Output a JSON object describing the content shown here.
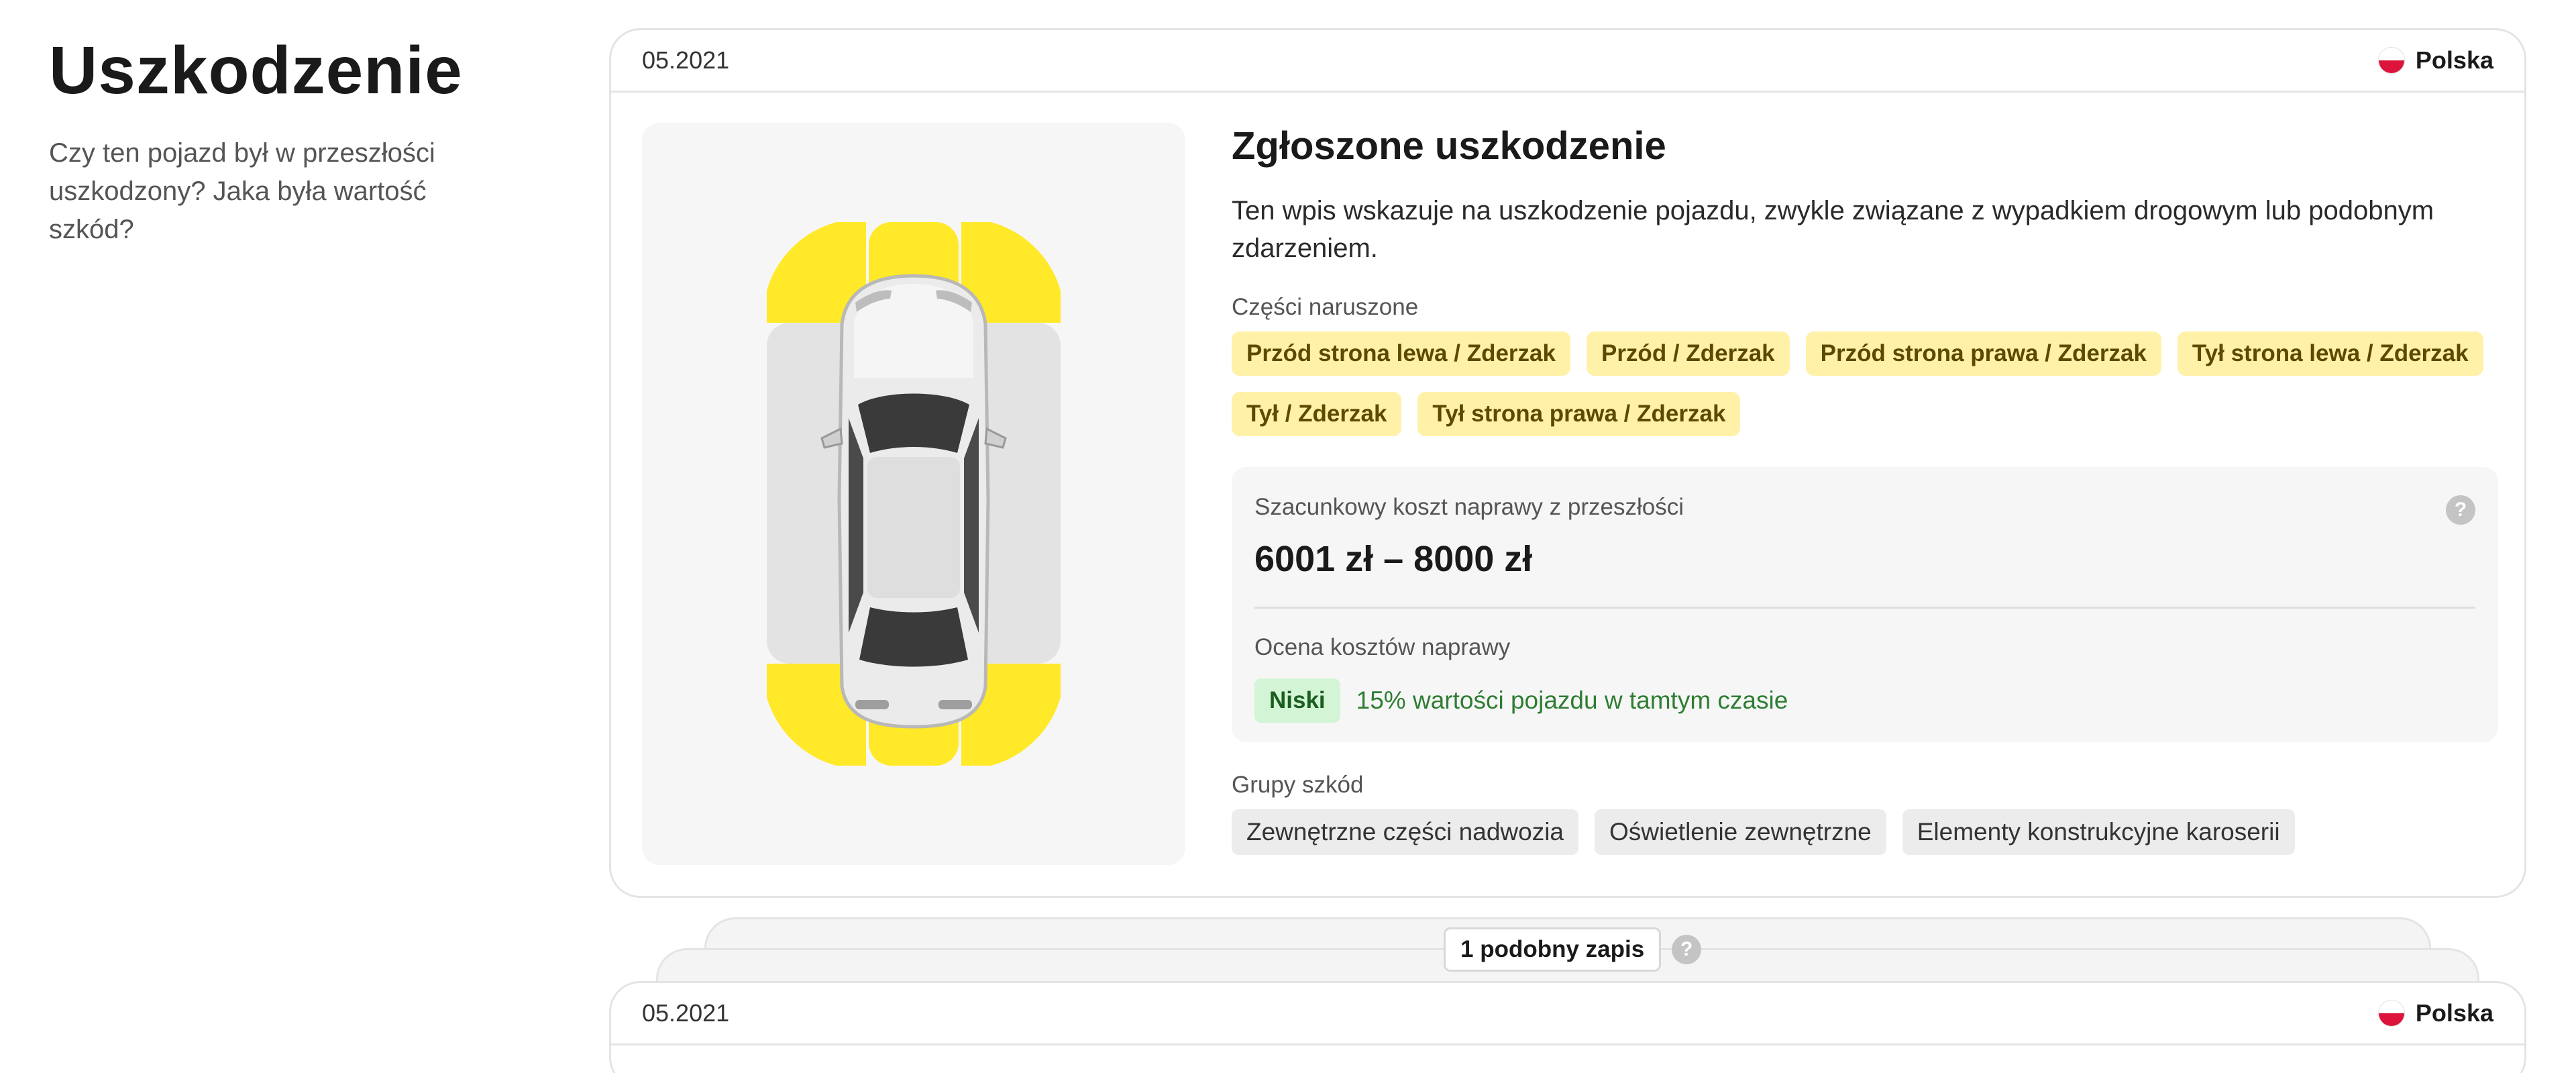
{
  "section": {
    "title": "Uszkodzenie",
    "description": "Czy ten pojazd był w przeszłości uszkodzony? Jaka była wartość szkód?"
  },
  "record": {
    "date": "05.2021",
    "country": "Polska",
    "title": "Zgłoszone uszkodzenie",
    "description": "Ten wpis wskazuje na uszkodzenie pojazdu, zwykle związane z wypadkiem drogowym lub podobnym zdarzeniem.",
    "parts_label": "Części naruszone",
    "parts": [
      "Przód strona lewa / Zderzak",
      "Przód / Zderzak",
      "Przód strona prawa / Zderzak",
      "Tył strona lewa / Zderzak",
      "Tył / Zderzak",
      "Tył strona prawa / Zderzak"
    ],
    "cost_label": "Szacunkowy koszt naprawy z przeszłości",
    "cost_value": "6001 zł – 8000 zł",
    "help_glyph": "?",
    "rating_label": "Ocena kosztów naprawy",
    "rating_badge": "Niski",
    "rating_text": "15% wartości pojazdu w tamtym czasie",
    "groups_label": "Grupy szkód",
    "groups": [
      "Zewnętrzne części nadwozia",
      "Oświetlenie zewnętrzne",
      "Elementy konstrukcyjne karoserii"
    ]
  },
  "similar": {
    "label": "1 podobny zapis",
    "help_glyph": "?"
  },
  "record2": {
    "date": "05.2021",
    "country": "Polska"
  },
  "colors": {
    "damage_zone": "#ffe928",
    "undamaged_zone": "#e3e3e3",
    "tag_yellow_bg": "#fff1a8",
    "badge_green_bg": "#d3f5d6",
    "flag_red": "#dc143c"
  },
  "icons": {
    "flag": "poland-flag-icon",
    "help": "question-circle-icon",
    "car": "car-top-view-icon"
  }
}
